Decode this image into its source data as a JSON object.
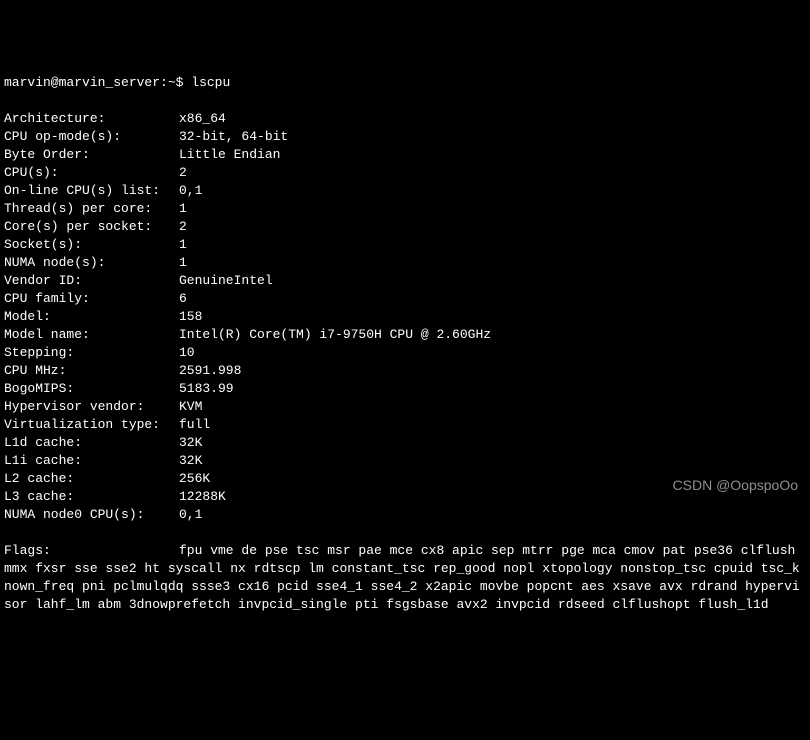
{
  "prompt": {
    "user_host": "marvin@marvin_server",
    "path": "~",
    "symbol": "$",
    "command": "lscpu"
  },
  "rows": [
    {
      "label": "Architecture:",
      "value": "x86_64"
    },
    {
      "label": "CPU op-mode(s):",
      "value": "32-bit, 64-bit"
    },
    {
      "label": "Byte Order:",
      "value": "Little Endian"
    },
    {
      "label": "CPU(s):",
      "value": "2"
    },
    {
      "label": "On-line CPU(s) list:",
      "value": "0,1"
    },
    {
      "label": "Thread(s) per core:",
      "value": "1"
    },
    {
      "label": "Core(s) per socket:",
      "value": "2"
    },
    {
      "label": "Socket(s):",
      "value": "1"
    },
    {
      "label": "NUMA node(s):",
      "value": "1"
    },
    {
      "label": "Vendor ID:",
      "value": "GenuineIntel"
    },
    {
      "label": "CPU family:",
      "value": "6"
    },
    {
      "label": "Model:",
      "value": "158"
    },
    {
      "label": "Model name:",
      "value": "Intel(R) Core(TM) i7-9750H CPU @ 2.60GHz"
    },
    {
      "label": "Stepping:",
      "value": "10"
    },
    {
      "label": "CPU MHz:",
      "value": "2591.998"
    },
    {
      "label": "BogoMIPS:",
      "value": "5183.99"
    },
    {
      "label": "Hypervisor vendor:",
      "value": "KVM"
    },
    {
      "label": "Virtualization type:",
      "value": "full"
    },
    {
      "label": "L1d cache:",
      "value": "32K"
    },
    {
      "label": "L1i cache:",
      "value": "32K"
    },
    {
      "label": "L2 cache:",
      "value": "256K"
    },
    {
      "label": "L3 cache:",
      "value": "12288K"
    },
    {
      "label": "NUMA node0 CPU(s):",
      "value": "0,1"
    }
  ],
  "flags": {
    "label": "Flags:",
    "value": "fpu vme de pse tsc msr pae mce cx8 apic sep mtrr pge mca cmov pat pse36 clflush mmx fxsr sse sse2 ht syscall nx rdtscp lm constant_tsc rep_good nopl xtopology nonstop_tsc cpuid tsc_known_freq pni pclmulqdq ssse3 cx16 pcid sse4_1 sse4_2 x2apic movbe popcnt aes xsave avx rdrand hypervisor lahf_lm abm 3dnowprefetch invpcid_single pti fsgsbase avx2 invpcid rdseed clflushopt flush_l1d"
  },
  "watermark": "CSDN @OopspoOo"
}
